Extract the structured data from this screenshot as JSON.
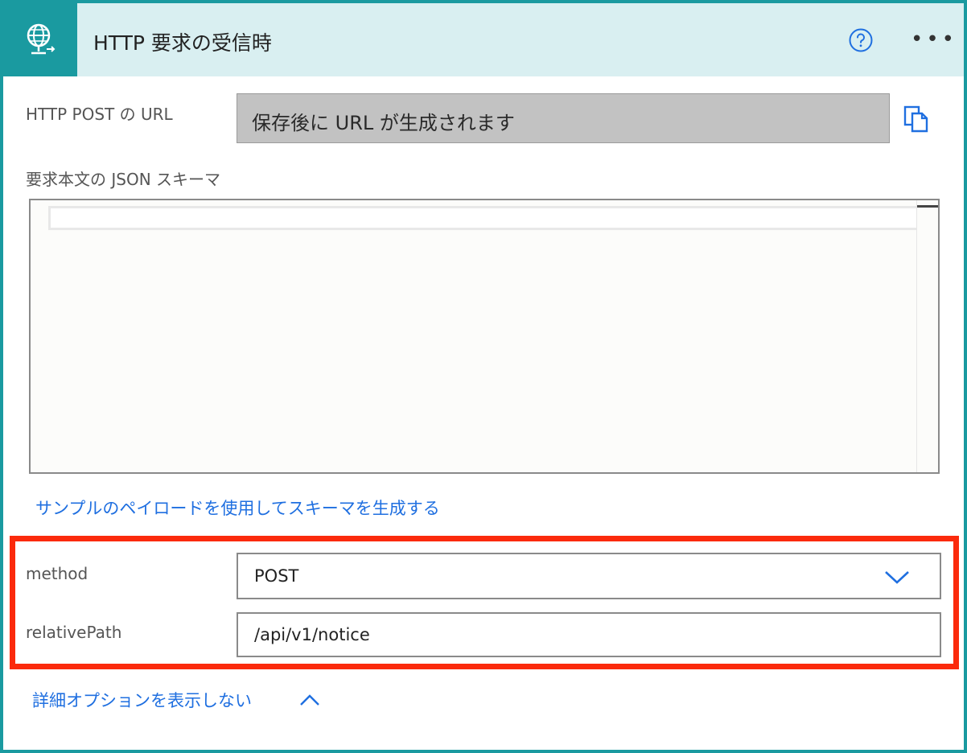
{
  "header": {
    "title": "HTTP 要求の受信時",
    "icon": "globe-network-icon",
    "help_icon": "help-circle-icon",
    "more_icon": "more-dots-icon",
    "more_label": "•••"
  },
  "url": {
    "label": "HTTP POST の URL",
    "value": "保存後に URL が生成されます",
    "copy_icon": "copy-icon"
  },
  "schema": {
    "label": "要求本文の JSON スキーマ",
    "value": ""
  },
  "links": {
    "generate_schema": "サンプルのペイロードを使用してスキーマを生成する",
    "toggle_advanced": "詳細オプションを表示しない"
  },
  "fields": {
    "method": {
      "label": "method",
      "value": "POST"
    },
    "relative_path": {
      "label": "relativePath",
      "value": "/api/v1/notice"
    }
  },
  "colors": {
    "accent": "#1a9aa0",
    "header_bg": "#d9eff1",
    "link": "#1f6fe0",
    "highlight": "#fb2a0c"
  }
}
